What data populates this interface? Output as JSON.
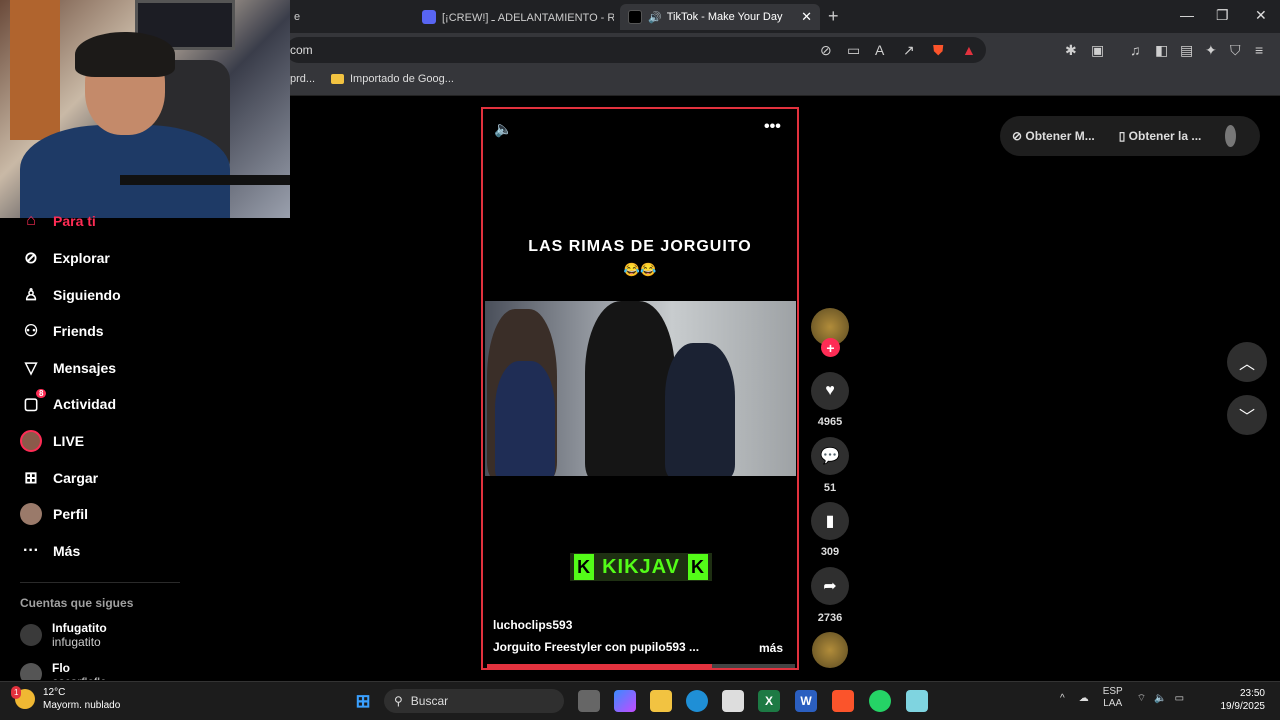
{
  "browser": {
    "tab_left_fragment": "e",
    "tabs": [
      {
        "label": "[¡CREW!] ـ ADELANTAMIENTO - R"
      },
      {
        "label": "TikTok - Make Your Day"
      }
    ],
    "url_fragment": "com",
    "bookmarks": [
      {
        "label": "prd..."
      },
      {
        "label": "Importado de Goog..."
      }
    ]
  },
  "sidebar": {
    "partial_top": "Para ti",
    "items": [
      {
        "label": "Explorar",
        "icon": "compass-icon"
      },
      {
        "label": "Siguiendo",
        "icon": "person-follow-icon"
      },
      {
        "label": "Friends",
        "icon": "friends-icon"
      },
      {
        "label": "Mensajes",
        "icon": "send-icon"
      },
      {
        "label": "Actividad",
        "icon": "inbox-icon",
        "badge": "8"
      },
      {
        "label": "LIVE",
        "icon": "live-icon"
      },
      {
        "label": "Cargar",
        "icon": "upload-icon"
      },
      {
        "label": "Perfil",
        "icon": "profile-icon"
      },
      {
        "label": "Más",
        "icon": "more-icon"
      }
    ],
    "following_header": "Cuentas que sigues",
    "following": [
      {
        "name": "Infugatito",
        "handle": "infugatito"
      },
      {
        "name": "Flo",
        "handle": "oscarflofle"
      }
    ]
  },
  "video": {
    "title": "LAS RIMAS DE JORGUITO",
    "emoji": "😂😂",
    "stream_brand": "KIKJAV",
    "author": "luchoclips593",
    "description": "Jorguito Freestyler con pupilo593 ...",
    "more_label": "más",
    "progress": 0.73
  },
  "actions": {
    "likes": "4965",
    "comments": "51",
    "saves": "309",
    "shares": "2736"
  },
  "top_right": {
    "get_app_1": "Obtener M...",
    "get_app_2": "Obtener la ..."
  },
  "taskbar": {
    "temperature": "12°C",
    "weather_desc": "Mayorm. nublado",
    "weather_badge": "1",
    "search_label": "Buscar",
    "lang": "ESP",
    "lang_sub": "LAA",
    "time": "23:50",
    "date": "19/9/2025"
  },
  "colors": {
    "accent": "#fe2c55",
    "video_border": "#e2323e",
    "kick_green": "#53fc18"
  }
}
